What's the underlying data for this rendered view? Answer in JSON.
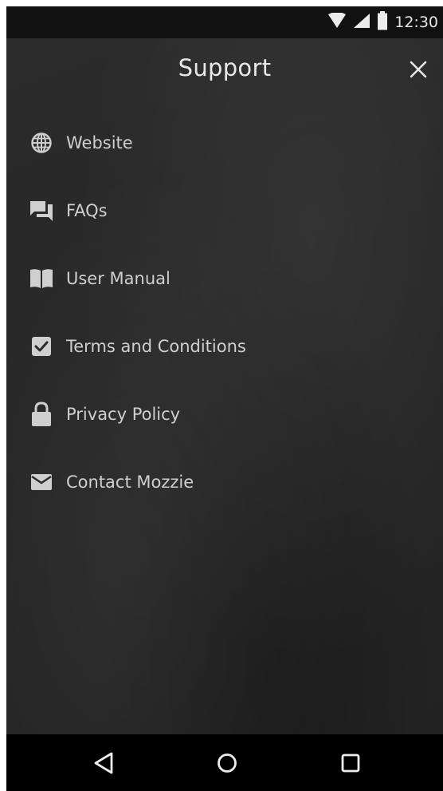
{
  "status_bar": {
    "time": "12:30",
    "icons": [
      "wifi-icon",
      "signal-icon",
      "battery-icon"
    ]
  },
  "header": {
    "title": "Support",
    "close_icon": "close-icon"
  },
  "menu": {
    "items": [
      {
        "label": "Website",
        "icon": "globe-icon"
      },
      {
        "label": "FAQs",
        "icon": "forum-icon"
      },
      {
        "label": "User Manual",
        "icon": "book-icon"
      },
      {
        "label": "Terms and Conditions",
        "icon": "checkbox-icon"
      },
      {
        "label": "Privacy Policy",
        "icon": "lock-icon"
      },
      {
        "label": "Contact Mozzie",
        "icon": "mail-icon"
      }
    ]
  },
  "nav_bar": {
    "icons": [
      "back-icon",
      "home-icon",
      "recents-icon"
    ]
  },
  "colors": {
    "background": "#262626",
    "status_bar": "#111111",
    "nav_bar": "#000000",
    "text": "#cfcfcf",
    "title": "#e9e9e9"
  }
}
